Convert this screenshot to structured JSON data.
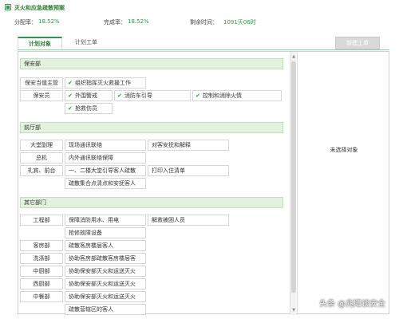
{
  "window": {
    "title": "灭火和应急疏散预案"
  },
  "stats": {
    "assign_label": "分配率：",
    "assign_value": "18.52%",
    "complete_label": "完成率：",
    "complete_value": "18.52%",
    "remaining_label": "剩余时间：",
    "remaining_value": "1091天06时"
  },
  "tabs": [
    {
      "label": "计划对象",
      "active": true
    },
    {
      "label": "计划工单",
      "active": false
    }
  ],
  "toolbar": {
    "new_order_label": "新建工单"
  },
  "detail": {
    "empty_text": "未选择对象"
  },
  "sections": {
    "security": "保安部",
    "front_office": "前厅部",
    "other": "其它部门"
  },
  "roles": {
    "security_supervisor": "保安当值主管",
    "security_guard": "保安员",
    "lobby_manager": "大堂副理",
    "switchboard": "总机",
    "concierge": "礼宾、前台",
    "engineering": "工程部",
    "housekeeping": "客房部",
    "laundry": "洗涤部",
    "chinese_kitchen": "中厨部",
    "western_kitchen": "西厨部",
    "banquet": "中餐部"
  },
  "tasks": {
    "organize_rescue": "组织指挥灭火救援工作",
    "outer_alert": "外围警戒",
    "fire_truck_guide": "消防车引导",
    "control_fire": "控制和消除火情",
    "rescue_injured": "抢救伤员",
    "site_comm": "现场通讯联络",
    "guest_comfort": "对客安抚和解释",
    "internal_comm": "内外通讯联络保障",
    "lobby_guide": "一、二楼大堂引导客人疏散",
    "print_list": "打印入住清单",
    "assembly_point": "疏散集合点清点和安抚客人",
    "fire_water": "保障消防用水、用电",
    "rescue_trapped": "解救被困人员",
    "repair_equipment": "抢修故障设备",
    "evac_floor_guests": "疏散客房楼层客人",
    "assist_housekeeping": "协助客房部疏散客房楼层客",
    "assist_security_1": "协助保安部灭火和运送灭火",
    "assist_security_2": "协助保安部灭火和运送灭火",
    "assist_security_3": "协助保安部灭火和运送灭火",
    "evac_area_guests": "疏散营辖区的客人"
  },
  "watermark": {
    "text": "头条 @兆阳谈安全"
  },
  "colors": {
    "accent": "#2e9b3e",
    "section_bg": "#e3f1df"
  },
  "icons": {
    "app": "app-icon",
    "check": "checkmark-icon"
  }
}
